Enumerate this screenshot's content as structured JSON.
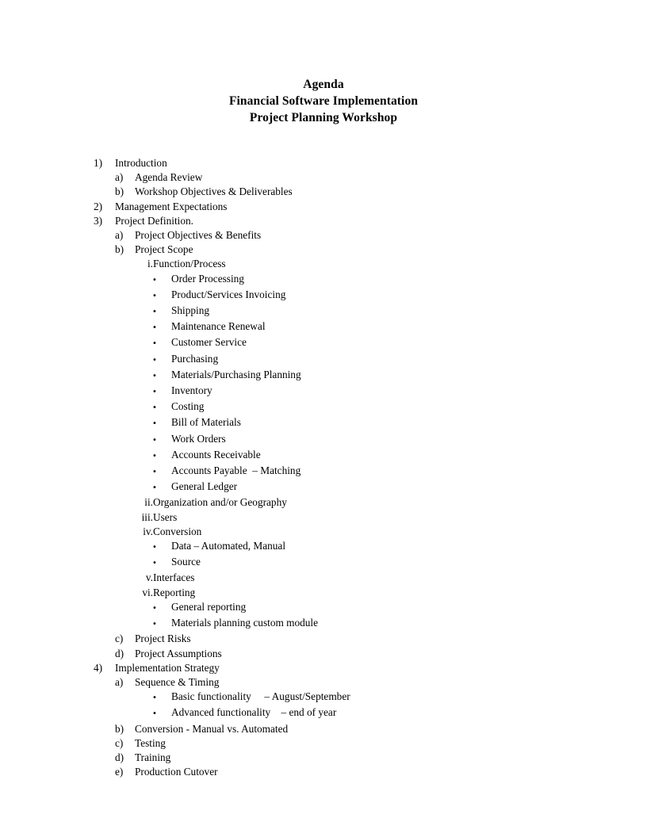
{
  "document": {
    "title_lines": [
      "Agenda",
      "Financial Software Implementation",
      "Project Planning Workshop"
    ]
  },
  "outline": [
    {
      "level": 1,
      "marker": "1)",
      "label": "Introduction"
    },
    {
      "level": 2,
      "marker": "a)",
      "label": "Agenda Review"
    },
    {
      "level": 2,
      "marker": "b)",
      "label": "Workshop Objectives & Deliverables"
    },
    {
      "level": 1,
      "marker": "2)",
      "label": "Management Expectations"
    },
    {
      "level": 1,
      "marker": "3)",
      "label": "Project Definition."
    },
    {
      "level": 2,
      "marker": "a)",
      "label": "Project Objectives & Benefits"
    },
    {
      "level": 2,
      "marker": "b)",
      "label": "Project Scope"
    },
    {
      "level": 3,
      "marker": "i.",
      "label": "Function/Process"
    },
    {
      "level": 4,
      "marker": "•",
      "label": "Order Processing"
    },
    {
      "level": 4,
      "marker": "•",
      "label": "Product/Services Invoicing"
    },
    {
      "level": 4,
      "marker": "•",
      "label": "Shipping"
    },
    {
      "level": 4,
      "marker": "•",
      "label": "Maintenance Renewal"
    },
    {
      "level": 4,
      "marker": "•",
      "label": "Customer Service"
    },
    {
      "level": 4,
      "marker": "•",
      "label": "Purchasing"
    },
    {
      "level": 4,
      "marker": "•",
      "label": "Materials/Purchasing Planning"
    },
    {
      "level": 4,
      "marker": "•",
      "label": "Inventory"
    },
    {
      "level": 4,
      "marker": "•",
      "label": "Costing"
    },
    {
      "level": 4,
      "marker": "•",
      "label": "Bill of Materials"
    },
    {
      "level": 4,
      "marker": "•",
      "label": "Work Orders"
    },
    {
      "level": 4,
      "marker": "•",
      "label": "Accounts Receivable"
    },
    {
      "level": 4,
      "marker": "•",
      "label": "Accounts Payable  – Matching"
    },
    {
      "level": 4,
      "marker": "•",
      "label": "General Ledger"
    },
    {
      "level": 3,
      "marker": "ii.",
      "label": "Organization and/or Geography"
    },
    {
      "level": 3,
      "marker": "iii.",
      "label": "Users"
    },
    {
      "level": 3,
      "marker": "iv.",
      "label": "Conversion"
    },
    {
      "level": 4,
      "marker": "•",
      "label": "Data – Automated, Manual"
    },
    {
      "level": 4,
      "marker": "•",
      "label": "Source"
    },
    {
      "level": 3,
      "marker": "v.",
      "label": "Interfaces"
    },
    {
      "level": 3,
      "marker": "vi.",
      "label": "Reporting"
    },
    {
      "level": 4,
      "marker": "•",
      "label": "General reporting"
    },
    {
      "level": 4,
      "marker": "•",
      "label": "Materials planning custom module"
    },
    {
      "level": 2,
      "marker": "c)",
      "label": "Project Risks"
    },
    {
      "level": 2,
      "marker": "d)",
      "label": "Project Assumptions"
    },
    {
      "level": 1,
      "marker": "4)",
      "label": "Implementation Strategy"
    },
    {
      "level": 2,
      "marker": "a)",
      "label": "Sequence & Timing"
    },
    {
      "level": 4,
      "marker": "•",
      "label": "Basic functionality     – August/September"
    },
    {
      "level": 4,
      "marker": "•",
      "label": "Advanced functionality    – end of year"
    },
    {
      "level": 2,
      "marker": "b)",
      "label": "Conversion - Manual vs. Automated"
    },
    {
      "level": 2,
      "marker": "c)",
      "label": "Testing"
    },
    {
      "level": 2,
      "marker": "d)",
      "label": "Training"
    },
    {
      "level": 2,
      "marker": "e)",
      "label": "Production Cutover"
    }
  ]
}
